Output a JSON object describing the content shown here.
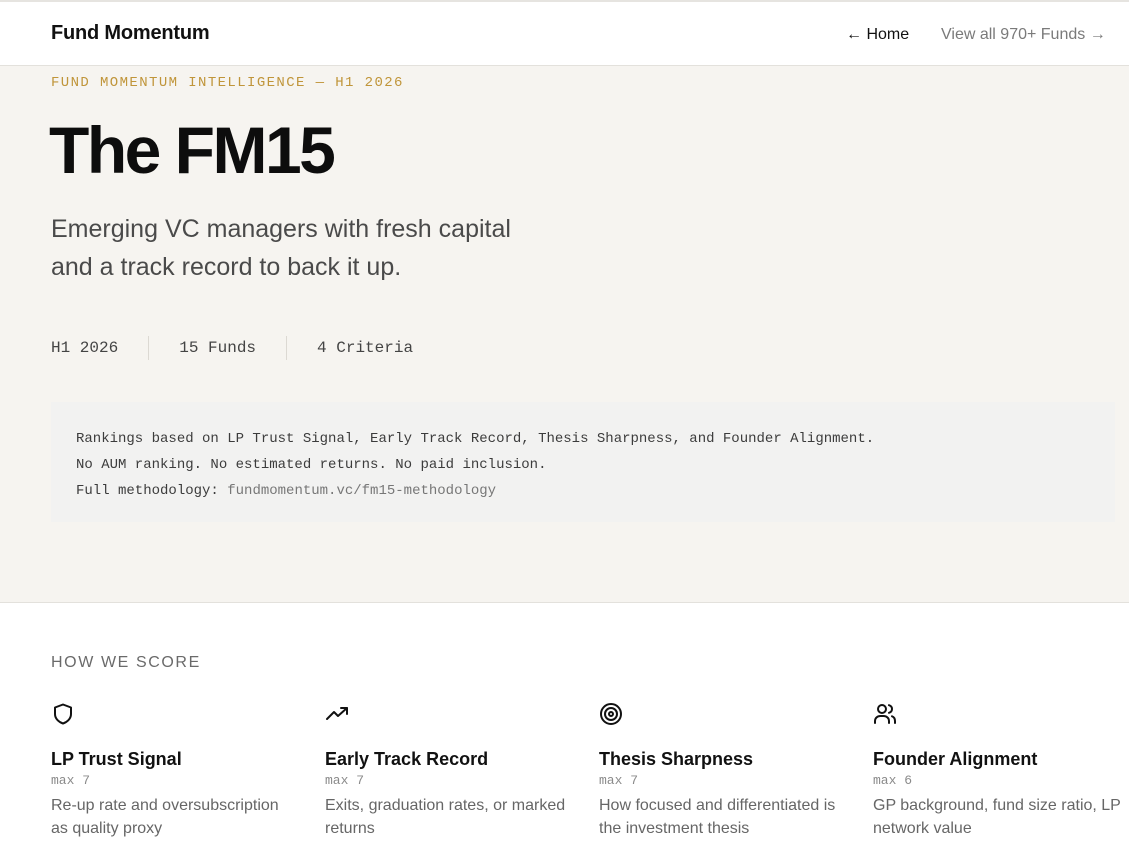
{
  "header": {
    "brand": "Fund Momentum",
    "home_label": "← Home",
    "view_all_label": "View all 970+ Funds →"
  },
  "hero": {
    "eyebrow": "FUND MOMENTUM INTELLIGENCE — H1 2026",
    "title": "The FM15",
    "subtitle_line1": "Emerging VC managers with fresh capital",
    "subtitle_line2": "and a track record to back it up.",
    "stats": [
      "H1 2026",
      "15 Funds",
      "4 Criteria"
    ]
  },
  "methodology": {
    "line1": "Rankings based on LP Trust Signal, Early Track Record, Thesis Sharpness, and Founder Alignment.",
    "line2": "No AUM ranking. No estimated returns. No paid inclusion.",
    "line3_prefix": "Full methodology: ",
    "link": "fundmomentum.vc/fm15-methodology"
  },
  "scoring": {
    "heading": "HOW WE SCORE",
    "criteria": [
      {
        "icon": "shield-icon",
        "title": "LP Trust Signal",
        "max": "max 7",
        "desc": "Re-up rate and oversubscription as quality proxy"
      },
      {
        "icon": "trending-up-icon",
        "title": "Early Track Record",
        "max": "max 7",
        "desc": "Exits, graduation rates, or marked returns"
      },
      {
        "icon": "target-icon",
        "title": "Thesis Sharpness",
        "max": "max 7",
        "desc": "How focused and differentiated is the investment thesis"
      },
      {
        "icon": "users-icon",
        "title": "Founder Alignment",
        "max": "max 6",
        "desc": "GP background, fund size ratio, LP network value"
      }
    ]
  },
  "colors": {
    "accent_gold": "#c0953a",
    "hero_bg": "#f6f4f0",
    "method_bg": "#f2f2f1"
  }
}
